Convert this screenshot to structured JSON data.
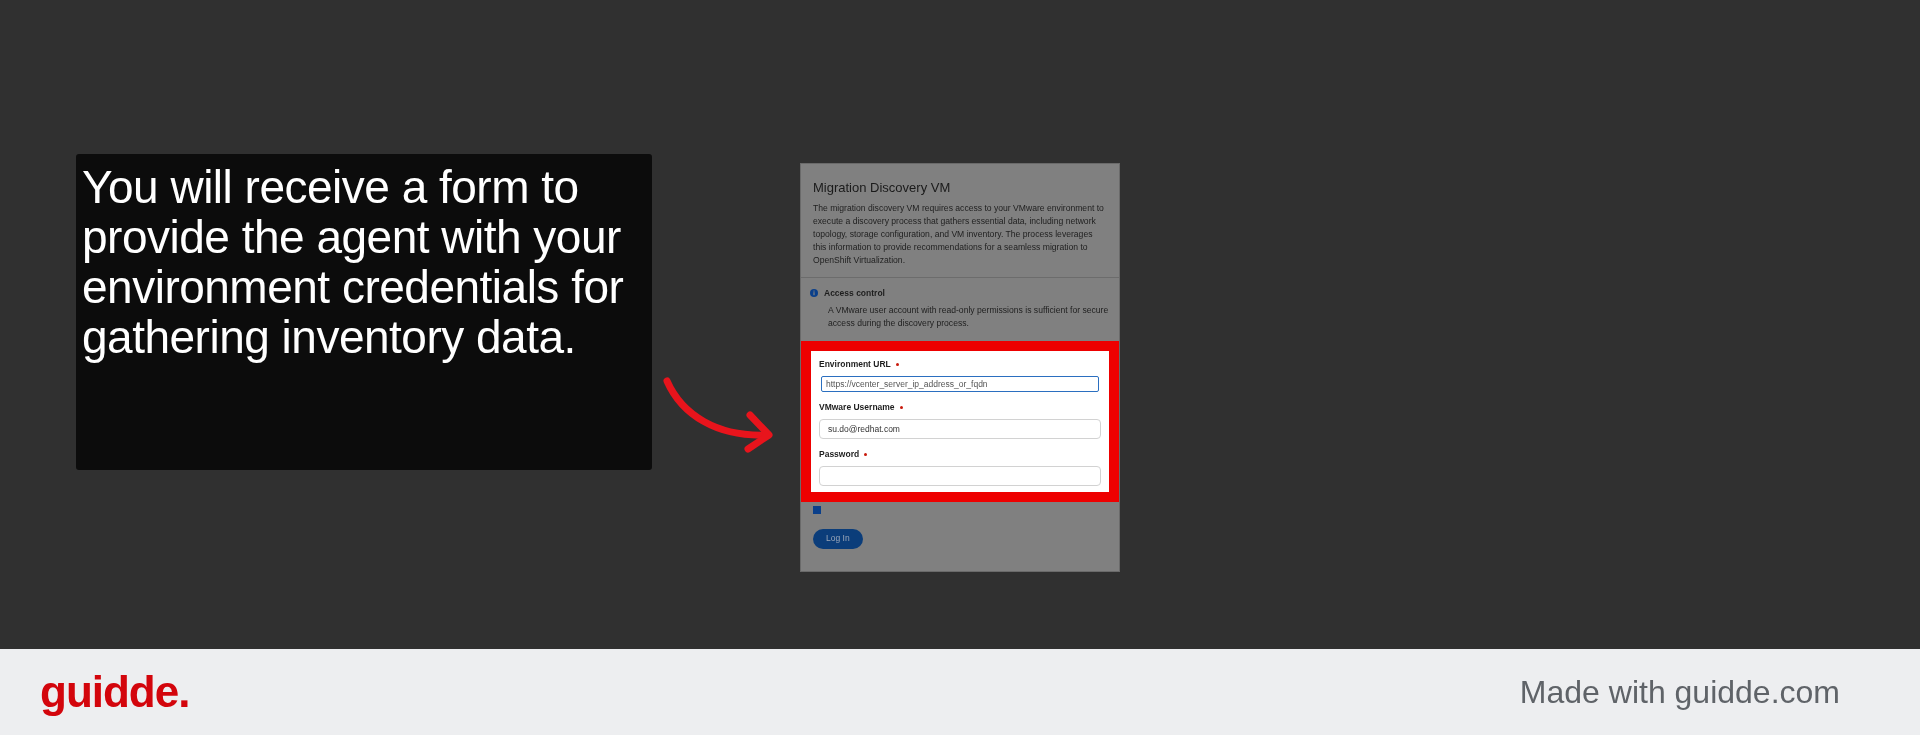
{
  "caption": "You will receive a form to provide the agent with your environment credentials for gathering inventory data.",
  "dialog": {
    "title": "Migration Discovery VM",
    "description": "The migration discovery VM requires access to your VMware environment to execute a discovery process that gathers essential data, including network topology, storage configuration, and VM inventory. The process leverages this information to provide recommendations for a seamless migration to OpenShift Virtualization.",
    "alert": {
      "title": "Access control",
      "body": "A VMware user account with read-only permissions is sufficient for secure access during the discovery process."
    },
    "fields": [
      {
        "label": "Environment URL",
        "required": true,
        "placeholder": "https://vcenter_server_ip_address_or_fqdn",
        "focused": true
      },
      {
        "label": "VMware Username",
        "required": true,
        "value": "su.do@redhat.com",
        "focused": false
      },
      {
        "label": "Password",
        "required": true,
        "focused": false
      }
    ],
    "checkbox": {
      "checked": true
    },
    "button": "Log In"
  },
  "footer": {
    "logo": "guidde.",
    "tagline": "Made with guidde.com"
  }
}
